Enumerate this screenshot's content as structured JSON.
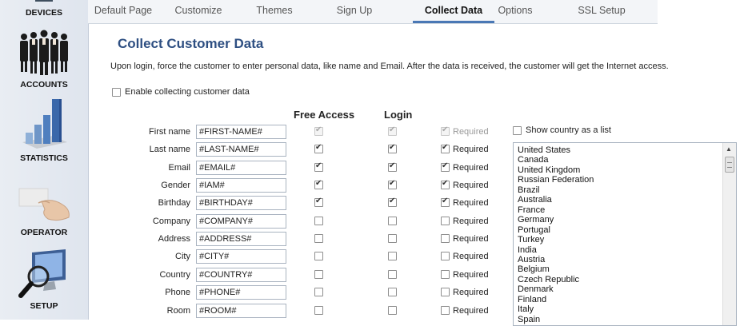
{
  "sidebar": {
    "items": [
      {
        "label": "DEVICES",
        "icon": "devices-icon"
      },
      {
        "label": "ACCOUNTS",
        "icon": "accounts-people-icon"
      },
      {
        "label": "STATISTICS",
        "icon": "statistics-bar-chart-icon"
      },
      {
        "label": "OPERATOR",
        "icon": "operator-card-hand-icon"
      },
      {
        "label": "SETUP",
        "icon": "setup-monitor-magnifier-icon"
      }
    ]
  },
  "tabs": [
    {
      "label": "Default Page",
      "active": false
    },
    {
      "label": "Customize",
      "active": false
    },
    {
      "label": "Themes",
      "active": false
    },
    {
      "label": "Sign Up",
      "active": false
    },
    {
      "label": "Collect Data",
      "active": true
    },
    {
      "label": "Options",
      "active": false
    },
    {
      "label": "SSL Setup",
      "active": false
    }
  ],
  "main": {
    "title": "Collect Customer Data",
    "description": "Upon login, force the customer to enter personal data, like name and Email. After the data is received, the customer will get the Internet access.",
    "enable_label": "Enable collecting customer data",
    "enable_checked": false,
    "col_free_access": "Free Access",
    "col_login": "Login",
    "required_label": "Required",
    "show_country_label": "Show country as a list",
    "show_country_checked": false
  },
  "fields": [
    {
      "label": "First name",
      "value": "#FIRST-NAME#",
      "free": true,
      "login": true,
      "required": true,
      "disabled": true
    },
    {
      "label": "Last name",
      "value": "#LAST-NAME#",
      "free": true,
      "login": true,
      "required": true,
      "disabled": false
    },
    {
      "label": "Email",
      "value": "#EMAIL#",
      "free": true,
      "login": true,
      "required": true,
      "disabled": false
    },
    {
      "label": "Gender",
      "value": "#IAM#",
      "free": true,
      "login": true,
      "required": true,
      "disabled": false
    },
    {
      "label": "Birthday",
      "value": "#BIRTHDAY#",
      "free": true,
      "login": true,
      "required": true,
      "disabled": false
    },
    {
      "label": "Company",
      "value": "#COMPANY#",
      "free": false,
      "login": false,
      "required": false,
      "disabled": false
    },
    {
      "label": "Address",
      "value": "#ADDRESS#",
      "free": false,
      "login": false,
      "required": false,
      "disabled": false
    },
    {
      "label": "City",
      "value": "#CITY#",
      "free": false,
      "login": false,
      "required": false,
      "disabled": false
    },
    {
      "label": "Country",
      "value": "#COUNTRY#",
      "free": false,
      "login": false,
      "required": false,
      "disabled": false
    },
    {
      "label": "Phone",
      "value": "#PHONE#",
      "free": false,
      "login": false,
      "required": false,
      "disabled": false
    },
    {
      "label": "Room",
      "value": "#ROOM#",
      "free": false,
      "login": false,
      "required": false,
      "disabled": false
    }
  ],
  "countries": [
    "United States",
    "Canada",
    "United Kingdom",
    "Russian Federation",
    "Brazil",
    "Australia",
    "France",
    "Germany",
    "Portugal",
    "Turkey",
    "India",
    "Austria",
    "Belgium",
    "Czech Republic",
    "Denmark",
    "Finland",
    "Italy",
    "Spain"
  ]
}
